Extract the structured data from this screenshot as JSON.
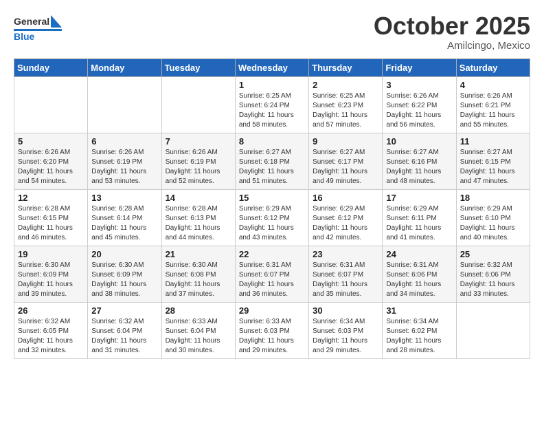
{
  "header": {
    "logo_general": "General",
    "logo_blue": "Blue",
    "month_title": "October 2025",
    "location": "Amilcingo, Mexico"
  },
  "weekdays": [
    "Sunday",
    "Monday",
    "Tuesday",
    "Wednesday",
    "Thursday",
    "Friday",
    "Saturday"
  ],
  "weeks": [
    [
      {
        "day": "",
        "info": ""
      },
      {
        "day": "",
        "info": ""
      },
      {
        "day": "",
        "info": ""
      },
      {
        "day": "1",
        "info": "Sunrise: 6:25 AM\nSunset: 6:24 PM\nDaylight: 11 hours\nand 58 minutes."
      },
      {
        "day": "2",
        "info": "Sunrise: 6:25 AM\nSunset: 6:23 PM\nDaylight: 11 hours\nand 57 minutes."
      },
      {
        "day": "3",
        "info": "Sunrise: 6:26 AM\nSunset: 6:22 PM\nDaylight: 11 hours\nand 56 minutes."
      },
      {
        "day": "4",
        "info": "Sunrise: 6:26 AM\nSunset: 6:21 PM\nDaylight: 11 hours\nand 55 minutes."
      }
    ],
    [
      {
        "day": "5",
        "info": "Sunrise: 6:26 AM\nSunset: 6:20 PM\nDaylight: 11 hours\nand 54 minutes."
      },
      {
        "day": "6",
        "info": "Sunrise: 6:26 AM\nSunset: 6:19 PM\nDaylight: 11 hours\nand 53 minutes."
      },
      {
        "day": "7",
        "info": "Sunrise: 6:26 AM\nSunset: 6:19 PM\nDaylight: 11 hours\nand 52 minutes."
      },
      {
        "day": "8",
        "info": "Sunrise: 6:27 AM\nSunset: 6:18 PM\nDaylight: 11 hours\nand 51 minutes."
      },
      {
        "day": "9",
        "info": "Sunrise: 6:27 AM\nSunset: 6:17 PM\nDaylight: 11 hours\nand 49 minutes."
      },
      {
        "day": "10",
        "info": "Sunrise: 6:27 AM\nSunset: 6:16 PM\nDaylight: 11 hours\nand 48 minutes."
      },
      {
        "day": "11",
        "info": "Sunrise: 6:27 AM\nSunset: 6:15 PM\nDaylight: 11 hours\nand 47 minutes."
      }
    ],
    [
      {
        "day": "12",
        "info": "Sunrise: 6:28 AM\nSunset: 6:15 PM\nDaylight: 11 hours\nand 46 minutes."
      },
      {
        "day": "13",
        "info": "Sunrise: 6:28 AM\nSunset: 6:14 PM\nDaylight: 11 hours\nand 45 minutes."
      },
      {
        "day": "14",
        "info": "Sunrise: 6:28 AM\nSunset: 6:13 PM\nDaylight: 11 hours\nand 44 minutes."
      },
      {
        "day": "15",
        "info": "Sunrise: 6:29 AM\nSunset: 6:12 PM\nDaylight: 11 hours\nand 43 minutes."
      },
      {
        "day": "16",
        "info": "Sunrise: 6:29 AM\nSunset: 6:12 PM\nDaylight: 11 hours\nand 42 minutes."
      },
      {
        "day": "17",
        "info": "Sunrise: 6:29 AM\nSunset: 6:11 PM\nDaylight: 11 hours\nand 41 minutes."
      },
      {
        "day": "18",
        "info": "Sunrise: 6:29 AM\nSunset: 6:10 PM\nDaylight: 11 hours\nand 40 minutes."
      }
    ],
    [
      {
        "day": "19",
        "info": "Sunrise: 6:30 AM\nSunset: 6:09 PM\nDaylight: 11 hours\nand 39 minutes."
      },
      {
        "day": "20",
        "info": "Sunrise: 6:30 AM\nSunset: 6:09 PM\nDaylight: 11 hours\nand 38 minutes."
      },
      {
        "day": "21",
        "info": "Sunrise: 6:30 AM\nSunset: 6:08 PM\nDaylight: 11 hours\nand 37 minutes."
      },
      {
        "day": "22",
        "info": "Sunrise: 6:31 AM\nSunset: 6:07 PM\nDaylight: 11 hours\nand 36 minutes."
      },
      {
        "day": "23",
        "info": "Sunrise: 6:31 AM\nSunset: 6:07 PM\nDaylight: 11 hours\nand 35 minutes."
      },
      {
        "day": "24",
        "info": "Sunrise: 6:31 AM\nSunset: 6:06 PM\nDaylight: 11 hours\nand 34 minutes."
      },
      {
        "day": "25",
        "info": "Sunrise: 6:32 AM\nSunset: 6:06 PM\nDaylight: 11 hours\nand 33 minutes."
      }
    ],
    [
      {
        "day": "26",
        "info": "Sunrise: 6:32 AM\nSunset: 6:05 PM\nDaylight: 11 hours\nand 32 minutes."
      },
      {
        "day": "27",
        "info": "Sunrise: 6:32 AM\nSunset: 6:04 PM\nDaylight: 11 hours\nand 31 minutes."
      },
      {
        "day": "28",
        "info": "Sunrise: 6:33 AM\nSunset: 6:04 PM\nDaylight: 11 hours\nand 30 minutes."
      },
      {
        "day": "29",
        "info": "Sunrise: 6:33 AM\nSunset: 6:03 PM\nDaylight: 11 hours\nand 29 minutes."
      },
      {
        "day": "30",
        "info": "Sunrise: 6:34 AM\nSunset: 6:03 PM\nDaylight: 11 hours\nand 29 minutes."
      },
      {
        "day": "31",
        "info": "Sunrise: 6:34 AM\nSunset: 6:02 PM\nDaylight: 11 hours\nand 28 minutes."
      },
      {
        "day": "",
        "info": ""
      }
    ]
  ]
}
